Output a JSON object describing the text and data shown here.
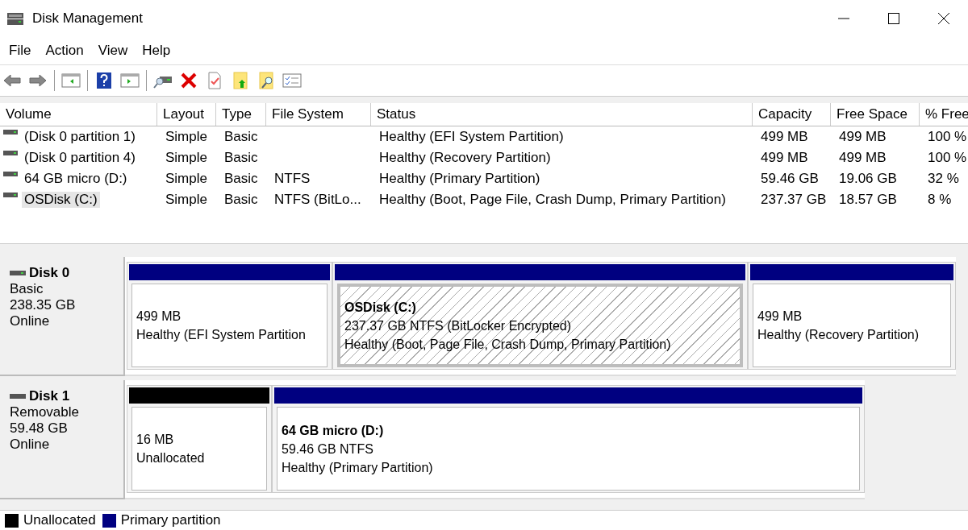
{
  "window": {
    "title": "Disk Management"
  },
  "menu": [
    "File",
    "Action",
    "View",
    "Help"
  ],
  "volumes": {
    "columns": [
      "Volume",
      "Layout",
      "Type",
      "File System",
      "Status",
      "Capacity",
      "Free Space",
      "% Free"
    ],
    "rows": [
      {
        "selected": false,
        "cells": [
          "(Disk 0 partition 1)",
          "Simple",
          "Basic",
          "",
          "Healthy (EFI System Partition)",
          "499 MB",
          "499 MB",
          "100 %"
        ]
      },
      {
        "selected": false,
        "cells": [
          "(Disk 0 partition 4)",
          "Simple",
          "Basic",
          "",
          "Healthy (Recovery Partition)",
          "499 MB",
          "499 MB",
          "100 %"
        ]
      },
      {
        "selected": false,
        "cells": [
          "64 GB micro (D:)",
          "Simple",
          "Basic",
          "NTFS",
          "Healthy (Primary Partition)",
          "59.46 GB",
          "19.06 GB",
          "32 %"
        ]
      },
      {
        "selected": true,
        "cells": [
          "OSDisk (C:)",
          "Simple",
          "Basic",
          "NTFS (BitLo...",
          "Healthy (Boot, Page File, Crash Dump, Primary Partition)",
          "237.37 GB",
          "18.57 GB",
          "8 %"
        ]
      }
    ]
  },
  "disks": [
    {
      "name": "Disk 0",
      "type": "Basic",
      "size": "238.35 GB",
      "status": "Online",
      "partitions": [
        {
          "kind": "primary",
          "selected": false,
          "lines": [
            "499 MB",
            "Healthy (EFI System Partition"
          ]
        },
        {
          "kind": "primary",
          "selected": true,
          "title": "OSDisk  (C:)",
          "lines": [
            "237.37 GB NTFS (BitLocker Encrypted)",
            "Healthy (Boot, Page File, Crash Dump, Primary Partition)"
          ]
        },
        {
          "kind": "primary",
          "selected": false,
          "lines": [
            "499 MB",
            "Healthy (Recovery Partition)"
          ]
        }
      ]
    },
    {
      "name": "Disk 1",
      "type": "Removable",
      "size": "59.48 GB",
      "status": "Online",
      "partitions": [
        {
          "kind": "unallocated",
          "selected": false,
          "lines": [
            "16 MB",
            "Unallocated"
          ]
        },
        {
          "kind": "primary",
          "selected": false,
          "title": "64 GB micro  (D:)",
          "lines": [
            "59.46 GB NTFS",
            "Healthy (Primary Partition)"
          ]
        }
      ]
    }
  ],
  "legend": [
    {
      "label": "Unallocated",
      "color": "#000000"
    },
    {
      "label": "Primary partition",
      "color": "#000080"
    }
  ]
}
